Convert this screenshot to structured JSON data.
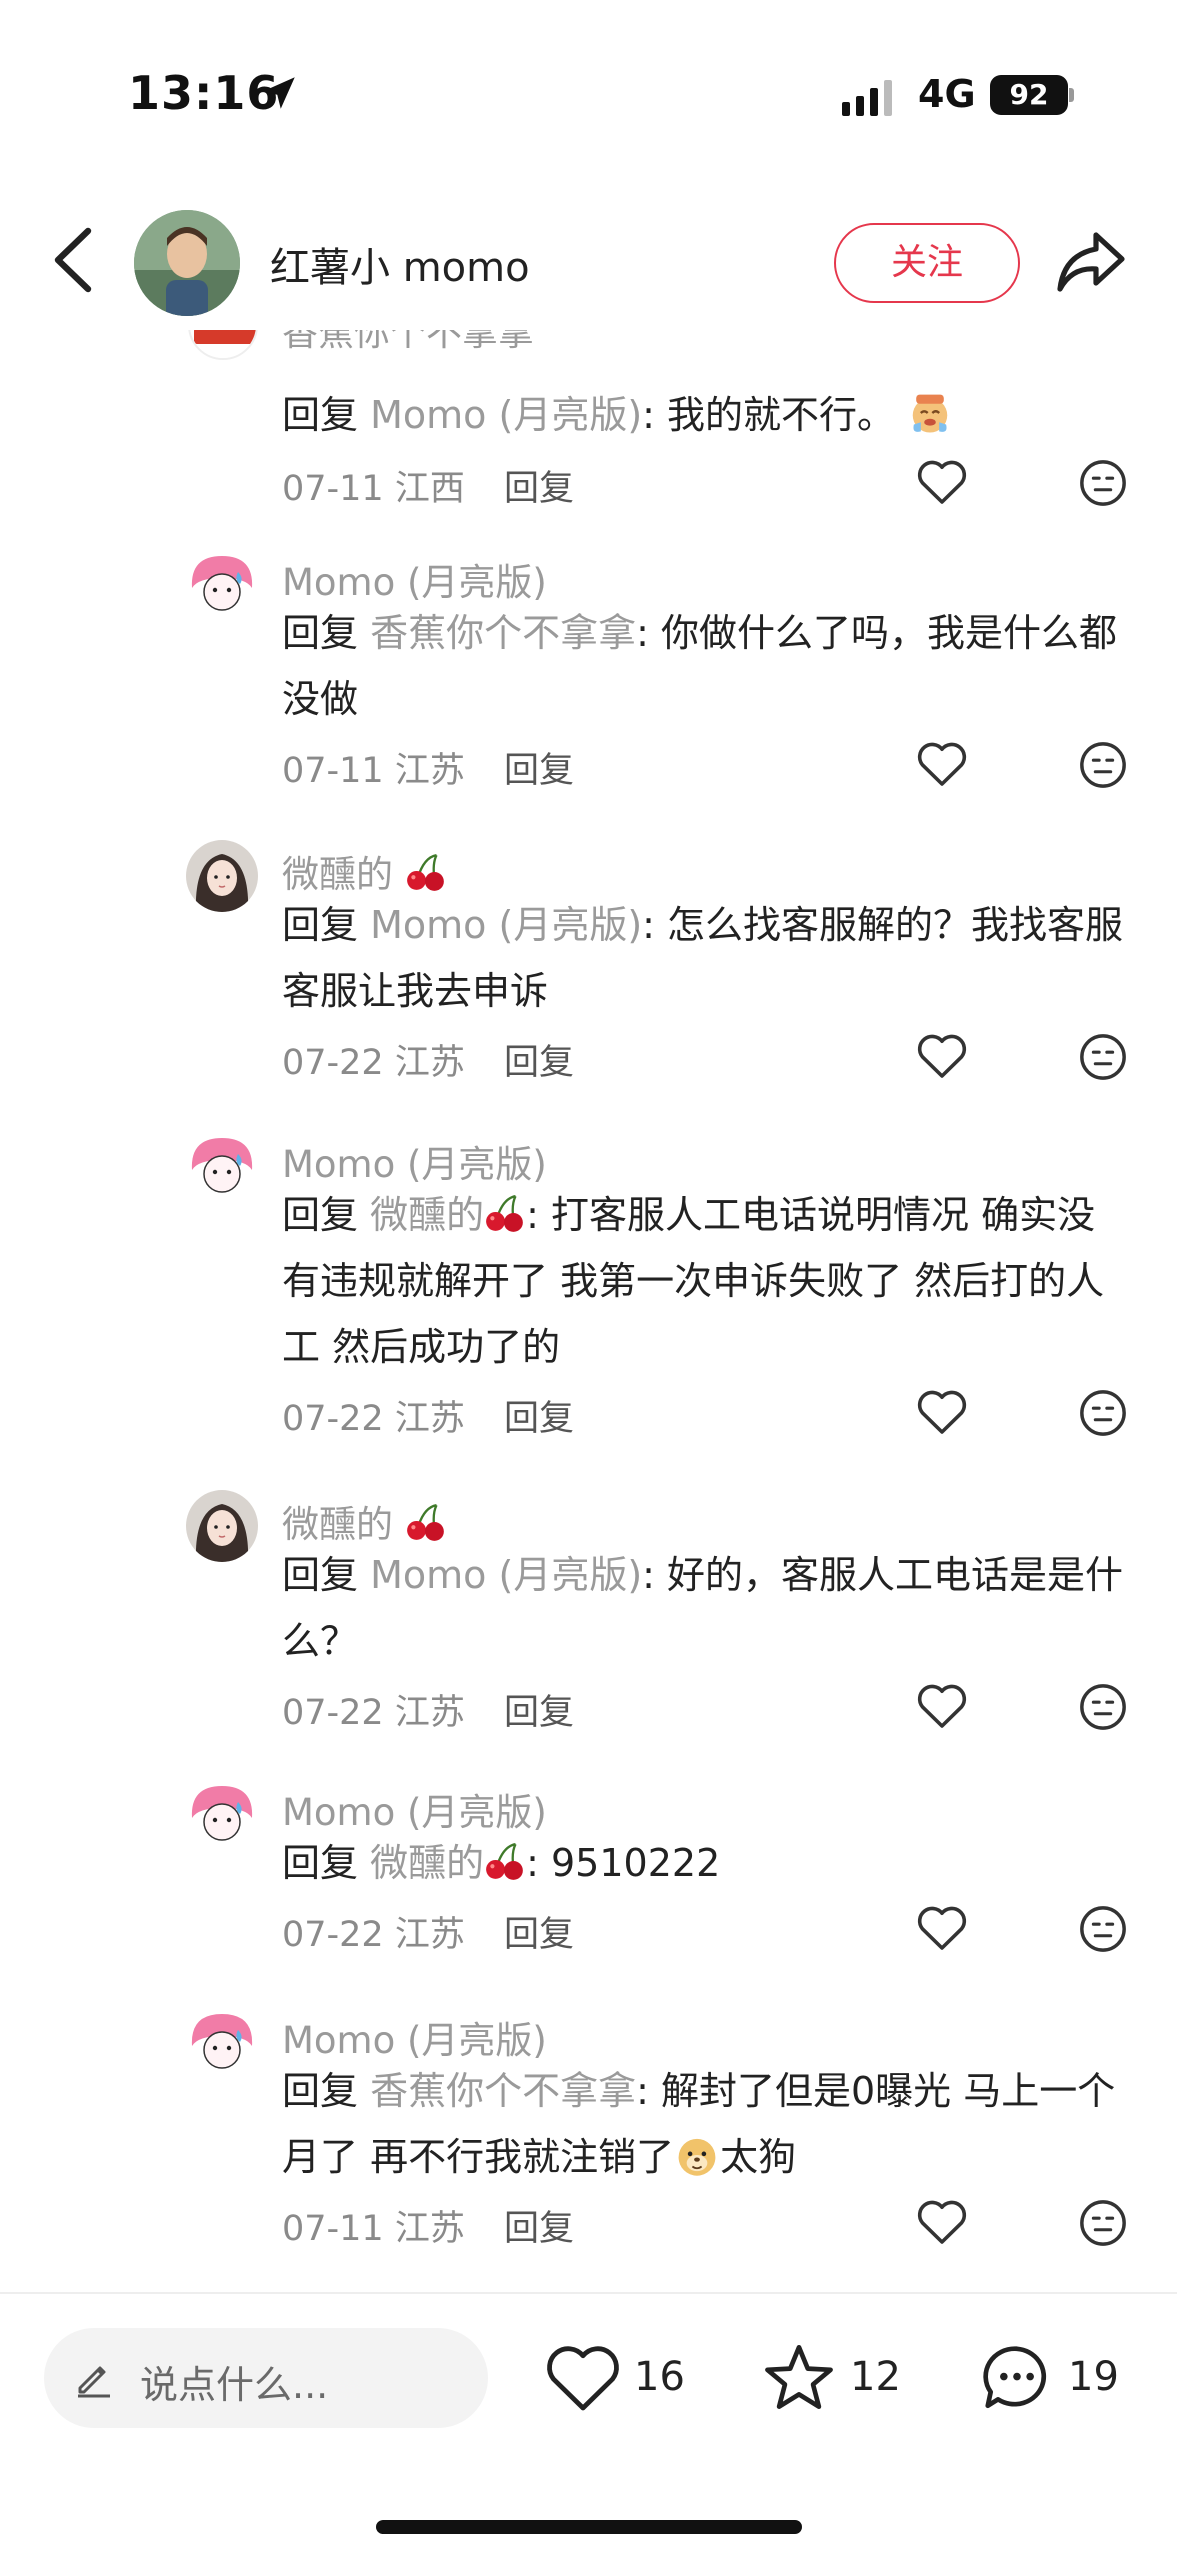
{
  "status_bar": {
    "time": "13:16",
    "network": "4G",
    "battery": "92"
  },
  "header": {
    "author_name": "红薯小 momo",
    "follow_label": "关注"
  },
  "partial_top_name": "香蕉你个不拿拿",
  "comments": [
    {
      "name": "",
      "reply_kw": "回复",
      "reply_to": "Momo (月亮版)",
      "text": ": 我的就不行。",
      "date": "07-11",
      "region": "江西",
      "reply_label": "回复"
    },
    {
      "name": "Momo (月亮版)",
      "reply_kw": "回复",
      "reply_to": "香蕉你个不拿拿",
      "text": ": 你做什么了吗，我是什么都没做",
      "date": "07-11",
      "region": "江苏",
      "reply_label": "回复"
    },
    {
      "name": "微醺的",
      "reply_kw": "回复",
      "reply_to": "Momo (月亮版)",
      "text": ": 怎么找客服解的？我找客服客服让我去申诉",
      "date": "07-22",
      "region": "江苏",
      "reply_label": "回复"
    },
    {
      "name": "Momo (月亮版)",
      "reply_kw": "回复",
      "reply_to": "微醺的",
      "text": ": 打客服人工电话说明情况 确实没有违规就解开了 我第一次申诉失败了 然后打的人工 然后成功了的",
      "date": "07-22",
      "region": "江苏",
      "reply_label": "回复"
    },
    {
      "name": "微醺的",
      "reply_kw": "回复",
      "reply_to": "Momo (月亮版)",
      "text": ": 好的，客服人工电话是是什么？",
      "date": "07-22",
      "region": "江苏",
      "reply_label": "回复"
    },
    {
      "name": "Momo (月亮版)",
      "reply_kw": "回复",
      "reply_to": "微醺的",
      "text": ": 9510222",
      "date": "07-22",
      "region": "江苏",
      "reply_label": "回复"
    },
    {
      "name": "Momo (月亮版)",
      "reply_kw": "回复",
      "reply_to": "香蕉你个不拿拿",
      "text": ": 解封了但是0曝光 马上一个月了 再不行我就注销了",
      "text_tail": "太狗",
      "date": "07-11",
      "region": "江苏",
      "reply_label": "回复"
    }
  ],
  "bottom_bar": {
    "input_placeholder": "说点什么...",
    "likes": "16",
    "stars": "12",
    "comments": "19"
  },
  "colors": {
    "accent": "#e5374c",
    "secondary_text": "#9a9a9a"
  },
  "icons": [
    "back-icon",
    "share-icon",
    "heart-icon",
    "dislike-face-icon",
    "pencil-icon",
    "star-icon",
    "comment-bubble-icon",
    "location-arrow-icon",
    "cherry-emoji",
    "crying-emoji",
    "doge-emoji"
  ]
}
